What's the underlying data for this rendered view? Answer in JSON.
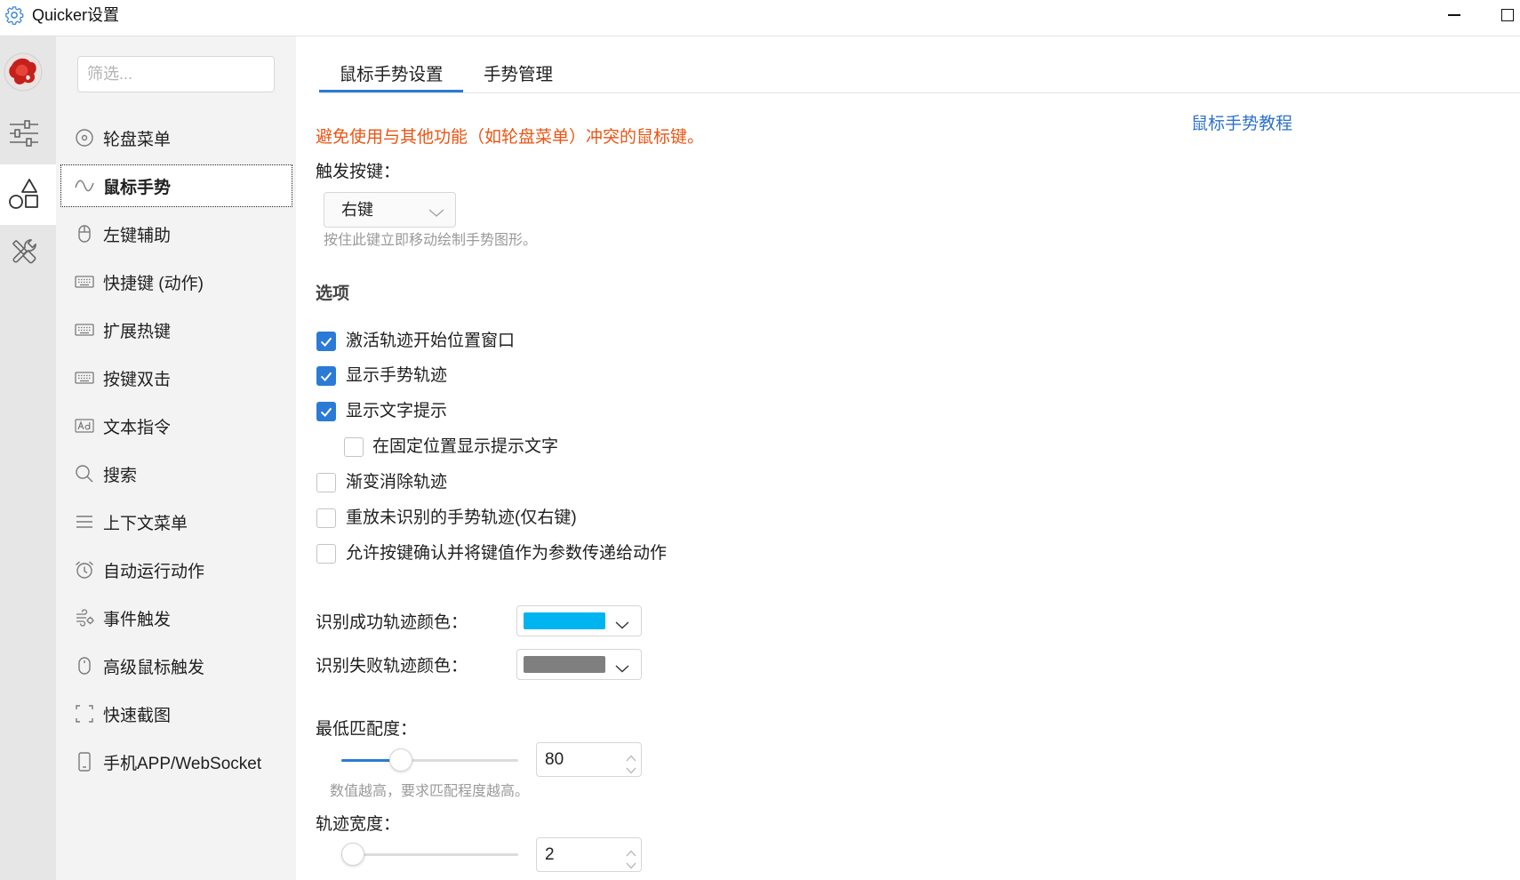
{
  "window": {
    "title": "Quicker设置",
    "icon": "gear-icon",
    "controls": [
      "minimize-icon",
      "maximize-icon"
    ]
  },
  "rail": {
    "items": [
      {
        "icon": "avatar"
      },
      {
        "icon": "sliders-icon"
      },
      {
        "icon": "shapes-icon",
        "selected": true
      },
      {
        "icon": "tools-icon"
      }
    ]
  },
  "sidebar": {
    "filter_placeholder": "筛选...",
    "selected_index": 1,
    "items": [
      {
        "label": "轮盘菜单",
        "icon": "wheel-menu-icon"
      },
      {
        "label": "鼠标手势",
        "icon": "gesture-wave-icon"
      },
      {
        "label": "左键辅助",
        "icon": "mouse-left-icon"
      },
      {
        "label": "快捷键 (动作)",
        "icon": "keyboard-icon"
      },
      {
        "label": "扩展热键",
        "icon": "keyboard-icon"
      },
      {
        "label": "按键双击",
        "icon": "keyboard-icon"
      },
      {
        "label": "文本指令",
        "icon": "text-ad-icon"
      },
      {
        "label": "搜索",
        "icon": "search-icon"
      },
      {
        "label": "上下文菜单",
        "icon": "menu-lines-icon"
      },
      {
        "label": "自动运行动作",
        "icon": "alarm-clock-icon"
      },
      {
        "label": "事件触发",
        "icon": "event-wind-icon"
      },
      {
        "label": "高级鼠标触发",
        "icon": "mouse-icon"
      },
      {
        "label": "快速截图",
        "icon": "screenshot-icon"
      },
      {
        "label": "手机APP/WebSocket",
        "icon": "phone-icon"
      }
    ]
  },
  "tabs": [
    {
      "label": "鼠标手势设置",
      "active": true
    },
    {
      "label": "手势管理",
      "active": false
    }
  ],
  "gesture": {
    "warning": "避免使用与其他功能（如轮盘菜单）冲突的鼠标键。",
    "tutorial_link": "鼠标手势教程",
    "trigger": {
      "label": "触发按键：",
      "value": "右键",
      "hint": "按住此键立即移动绘制手势图形。"
    },
    "options_title": "选项",
    "options": [
      {
        "label": "激活轨迹开始位置窗口",
        "checked": true,
        "indent": false
      },
      {
        "label": "显示手势轨迹",
        "checked": true,
        "indent": false
      },
      {
        "label": "显示文字提示",
        "checked": true,
        "indent": false
      },
      {
        "label": "在固定位置显示提示文字",
        "checked": false,
        "indent": true
      },
      {
        "label": "渐变消除轨迹",
        "checked": false,
        "indent": false
      },
      {
        "label": "重放未识别的手势轨迹(仅右键)",
        "checked": false,
        "indent": false
      },
      {
        "label": "允许按键确认并将键值作为参数传递给动作",
        "checked": false,
        "indent": false
      }
    ],
    "success_color": {
      "label": "识别成功轨迹颜色：",
      "color": "#00b4f0"
    },
    "fail_color": {
      "label": "识别失败轨迹颜色：",
      "color": "#7f7f7f"
    },
    "min_match": {
      "label": "最低匹配度：",
      "value": "80",
      "slider_level": 0.31,
      "hint": "数值越高，要求匹配程度越高。"
    },
    "stroke_width": {
      "label": "轨迹宽度：",
      "value": "2",
      "slider_level": 0
    }
  },
  "colors": {
    "accent": "#2b7bd6",
    "warning": "#ea5514",
    "link": "#2f72c8"
  }
}
